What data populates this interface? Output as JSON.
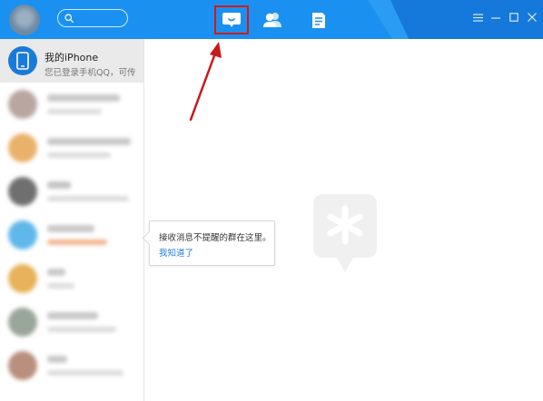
{
  "header": {
    "search": {
      "placeholder": ""
    },
    "nav": [
      {
        "name": "messages",
        "icon": "chat-bubble-icon"
      },
      {
        "name": "contacts",
        "icon": "contacts-icon"
      },
      {
        "name": "files",
        "icon": "document-icon"
      }
    ],
    "window_controls": [
      "menu-icon",
      "minimize-icon",
      "maximize-icon",
      "close-icon"
    ]
  },
  "sidebar": {
    "first_contact": {
      "name": "我的iPhone",
      "subtitle": "您已登录手机QQ，可传"
    }
  },
  "tooltip": {
    "message": "接收消息不提醒的群在这里。",
    "link": "我知道了"
  },
  "colors": {
    "titlebar": "#1a91f0",
    "highlight_box": "#d01a1a",
    "annotation_arrow": "#c8191d",
    "link": "#1a7ad8"
  }
}
